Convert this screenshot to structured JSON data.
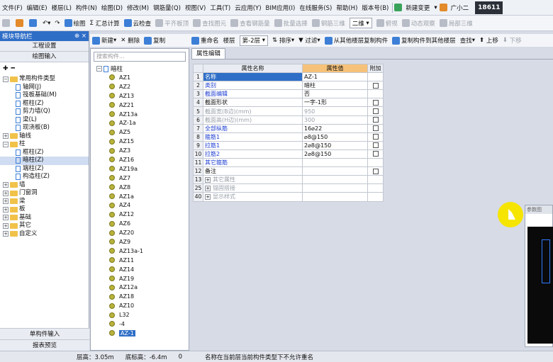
{
  "menu": [
    "文件(F)",
    "编辑(E)",
    "楼层(L)",
    "构件(N)",
    "绘图(D)",
    "修改(M)",
    "钢筋量(Q)",
    "视图(V)",
    "工具(T)",
    "云应用(Y)",
    "BIM应用(I)",
    "在线服务(S)",
    "帮助(H)",
    "版本号(B)"
  ],
  "menu_right": {
    "new_change": "新建变更",
    "user": "广小二",
    "phone": "18611"
  },
  "toolbar": {
    "draw": "绘图",
    "sum": "汇总计算",
    "cloud_check": "云检查",
    "flat_board": "平齐板顶",
    "find_element": "查找图元",
    "view_rebar": "查看钢筋量",
    "batch_select": "批量选择",
    "rebar_3d": "钢筋三维",
    "view_mode": "二维",
    "top_view": "俯视",
    "dynamic": "动态观察",
    "local_3d": "局部三维"
  },
  "left_panel": {
    "title": "模块导航栏",
    "pin": "⊕ ×",
    "btn_project": "工程设置",
    "btn_draw": "绘图输入",
    "tree_root": "常用构件类型",
    "common": [
      "轴网(J)",
      "筏板基础(M)",
      "框柱(Z)",
      "剪力墙(Q)",
      "梁(L)",
      "现浇板(B)"
    ],
    "axis": "轴线",
    "column": "柱",
    "column_items": [
      "框柱(Z)",
      "暗柱(Z)",
      "端柱(Z)",
      "构造柱(Z)"
    ],
    "others": [
      "墙",
      "门窗洞",
      "梁",
      "板",
      "基础",
      "其它",
      "自定义"
    ],
    "btn_single": "单构件输入",
    "btn_report": "报表预览"
  },
  "mid_tools": {
    "new": "新建",
    "delete": "删除",
    "copy": "复制"
  },
  "mid_panel": {
    "search_placeholder": "搜索构件...",
    "root": "暗柱",
    "items": [
      "AZ1",
      "AZ2",
      "AZ13",
      "AZ21",
      "AZ13a",
      "AZ-1a",
      "AZ5",
      "AZ15",
      "AZ3",
      "AZ16",
      "AZ19a",
      "AZ7",
      "AZ8",
      "AZ1a",
      "AZ4",
      "AZ12",
      "AZ6",
      "AZ20",
      "AZ9",
      "AZ13a-1",
      "AZ11",
      "AZ14",
      "AZ19",
      "AZ12a",
      "AZ18",
      "AZ10",
      "L32",
      "-4",
      "AZ-1"
    ],
    "selected": "AZ-1"
  },
  "right_tools": {
    "rename": "重命名",
    "floor": "楼层",
    "floor_val": "第-2层",
    "sort": "排序",
    "filter": "过滤",
    "copy_from": "从其他楼层复制构件",
    "copy_to": "复制构件到其他楼层",
    "find": "查找",
    "up": "上移",
    "down": "下移"
  },
  "tab": "属性编辑",
  "grid": {
    "headers": {
      "name": "属性名称",
      "value": "属性值",
      "add": "附加"
    },
    "rows": [
      {
        "idx": "1",
        "name": "名称",
        "value": "AZ-1",
        "color": "blue",
        "chk": false,
        "plus": false
      },
      {
        "idx": "2",
        "name": "类别",
        "value": "暗柱",
        "color": "blue",
        "chk": true,
        "plus": false
      },
      {
        "idx": "3",
        "name": "截面编辑",
        "value": "否",
        "color": "blue",
        "chk": false,
        "plus": false
      },
      {
        "idx": "4",
        "name": "截面形状",
        "value": "一字-1形",
        "color": "black",
        "chk": true,
        "plus": false
      },
      {
        "idx": "5",
        "name": "截面宽(B边)(mm)",
        "value": "950",
        "color": "gray",
        "chk": true,
        "plus": false
      },
      {
        "idx": "6",
        "name": "截面高(H边)(mm)",
        "value": "300",
        "color": "gray",
        "chk": true,
        "plus": false
      },
      {
        "idx": "7",
        "name": "全部纵筋",
        "value": "16⌀22",
        "color": "blue",
        "chk": true,
        "plus": false
      },
      {
        "idx": "8",
        "name": "箍筋1",
        "value": "⌀8@150",
        "color": "blue",
        "chk": true,
        "plus": false
      },
      {
        "idx": "9",
        "name": "拉筋1",
        "value": "2⌀8@150",
        "color": "blue",
        "chk": true,
        "plus": false
      },
      {
        "idx": "10",
        "name": "拉筋2",
        "value": "2⌀8@150",
        "color": "blue",
        "chk": true,
        "plus": false
      },
      {
        "idx": "11",
        "name": "其它箍筋",
        "value": "",
        "color": "blue",
        "chk": false,
        "plus": false
      },
      {
        "idx": "12",
        "name": "备注",
        "value": "",
        "color": "black",
        "chk": true,
        "plus": false
      },
      {
        "idx": "13",
        "name": "其它属性",
        "value": "",
        "color": "gray",
        "chk": false,
        "plus": true
      },
      {
        "idx": "25",
        "name": "锚固搭接",
        "value": "",
        "color": "gray",
        "chk": false,
        "plus": true
      },
      {
        "idx": "40",
        "name": "显示样式",
        "value": "",
        "color": "gray",
        "chk": false,
        "plus": true
      }
    ]
  },
  "preview_title": "参数图",
  "status": {
    "floor_height": "层高：3.05m",
    "bottom_elev": "底标高：-6.4m",
    "zero": "0",
    "message": "名称在当前层当前构件类型下不允许重名"
  }
}
